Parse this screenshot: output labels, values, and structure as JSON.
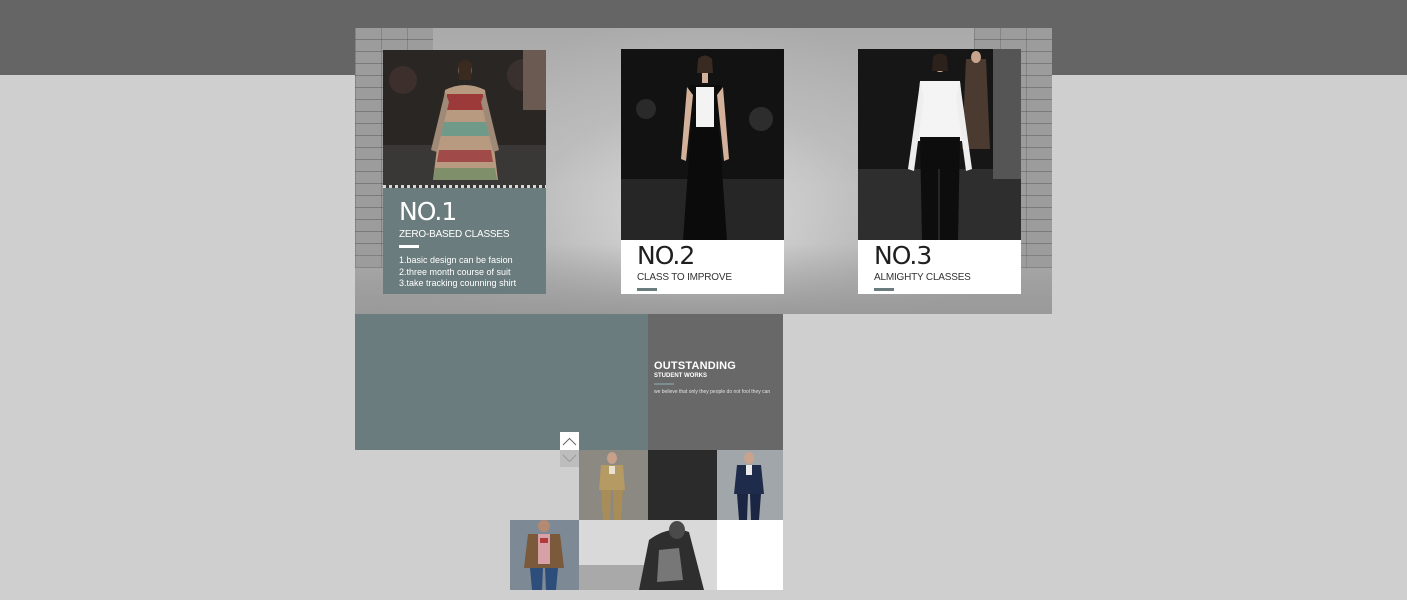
{
  "classes": [
    {
      "number": "NO.1",
      "subtitle": "ZERO-BASED CLASSES",
      "items": [
        "1.basic design can be fasion",
        "2.three month course of suit",
        "3.take tracking counning shirt"
      ]
    },
    {
      "number": "NO.2",
      "subtitle": "CLASS TO IMPROVE"
    },
    {
      "number": "NO.3",
      "subtitle": "ALMIGHTY CLASSES"
    }
  ],
  "outstanding": {
    "title": "OUTSTANDING",
    "subtitle": "STUDENT WORKS",
    "description": "we believe that only they people do not fool they can"
  },
  "colors": {
    "accent_teal": "#6b7c7e",
    "dark_gray": "#686868",
    "top_band": "#656565",
    "background": "#cfcfcf"
  },
  "icons": {
    "scroll_up": "chevron-up-icon",
    "scroll_down": "chevron-down-icon"
  }
}
